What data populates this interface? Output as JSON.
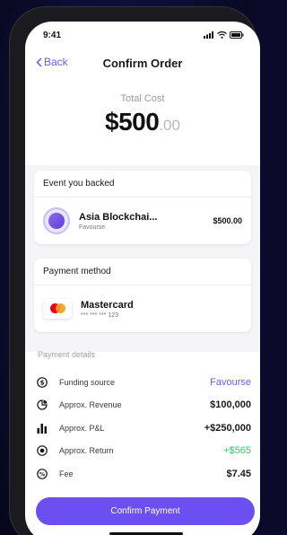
{
  "status_bar": {
    "time": "9:41"
  },
  "nav": {
    "back_label": "Back",
    "title": "Confirm Order"
  },
  "summary": {
    "label": "Total Cost",
    "amount_main": "$500",
    "amount_cents": ".00"
  },
  "event_card": {
    "title": "Event you backed",
    "name": "Asia Blockchai...",
    "subtitle": "Favourse",
    "amount": "$500.00"
  },
  "payment_card": {
    "title": "Payment method",
    "method_name": "Mastercard",
    "masked_number": "*** *** *** 123"
  },
  "details": {
    "title": "Payment details",
    "rows": [
      {
        "icon": "dollar-circle-icon",
        "label": "Funding source",
        "value": "Favourse",
        "style": "purple"
      },
      {
        "icon": "pie-chart-icon",
        "label": "Approx. Revenue",
        "value": "$100,000",
        "style": "bold"
      },
      {
        "icon": "bar-chart-icon",
        "label": "Approx. P&L",
        "value": "+$250,000",
        "style": "bold"
      },
      {
        "icon": "target-icon",
        "label": "Approx. Return",
        "value": "+$565",
        "style": "green"
      },
      {
        "icon": "percent-icon",
        "label": "Fee",
        "value": "$7.45",
        "style": "bold"
      }
    ]
  },
  "confirm_button": {
    "label": "Confirm Payment"
  },
  "colors": {
    "accent": "#6c4ff0",
    "link": "#6c5ce7",
    "positive": "#2ecc71"
  }
}
